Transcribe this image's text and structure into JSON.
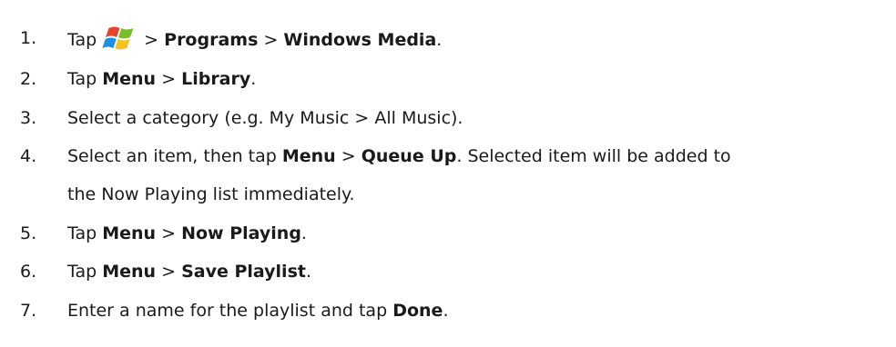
{
  "steps": [
    {
      "number": "1.",
      "parts": [
        "Tap",
        ">",
        "Programs",
        ">",
        "Windows Media",
        "."
      ],
      "icon": "windows-start-icon"
    },
    {
      "number": "2.",
      "parts": [
        "Tap",
        "Menu",
        ">",
        "Library",
        "."
      ]
    },
    {
      "number": "3.",
      "text": "Select a category (e.g. My Music > All Music)."
    },
    {
      "number": "4.",
      "parts": [
        "Select an item, then tap",
        "Menu",
        ">",
        "Queue Up",
        ". Selected item will be added to"
      ],
      "continuation": "the Now Playing list immediately."
    },
    {
      "number": "5.",
      "parts": [
        "Tap",
        "Menu",
        ">",
        "Now Playing",
        "."
      ]
    },
    {
      "number": "6.",
      "parts": [
        "Tap",
        "Menu",
        ">",
        "Save Playlist",
        "."
      ]
    },
    {
      "number": "7.",
      "parts": [
        "Enter a name for the playlist and tap",
        "Done",
        "."
      ]
    }
  ]
}
